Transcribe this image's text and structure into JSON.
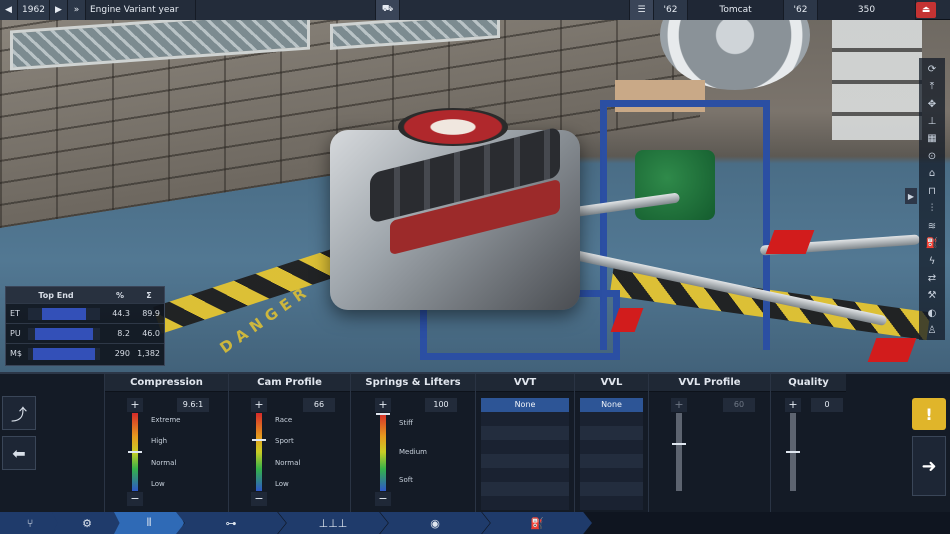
{
  "topbar": {
    "prev_year_icon": "back-arrow-icon",
    "year": "1962",
    "prev_model_icon": "play-left-icon",
    "next_model_icon": "play-right-icon",
    "label": "Engine Variant year",
    "car_icon": "car-icon",
    "list_icon": "list-icon",
    "variant_year": "'62",
    "variant_name": "Tomcat",
    "family_year": "'62",
    "family_value": "350",
    "exit_icon": "exit-icon"
  },
  "right_tools": [
    "refresh-icon",
    "lift-icon",
    "camera-icon",
    "valve-icon",
    "block-icon",
    "cam-icon",
    "head-icon",
    "piston-icon",
    "intake-icon",
    "exhaust-icon",
    "fuel-icon",
    "spark-icon",
    "move-icon",
    "wrench-icon",
    "oil-icon",
    "person-icon"
  ],
  "stats": {
    "title": "Top End",
    "col_pct": "%",
    "col_sum": "Σ",
    "rows": [
      {
        "label": "ET",
        "pct": "44.3",
        "sum": "89.9",
        "fill": 0.62
      },
      {
        "label": "PU",
        "pct": "8.2",
        "sum": "46.0",
        "fill": 0.8
      },
      {
        "label": "M$",
        "pct": "290",
        "sum": "1,382",
        "fill": 0.85
      }
    ]
  },
  "sections": {
    "compression": {
      "title": "Compression",
      "value": "9.6:1",
      "labels": [
        "Extreme",
        "High",
        "Normal",
        "Low"
      ],
      "level": 0.5
    },
    "cam": {
      "title": "Cam Profile",
      "value": "66",
      "labels": [
        "Race",
        "Sport",
        "Normal",
        "Low"
      ],
      "level": 0.66
    },
    "springs": {
      "title": "Springs & Lifters",
      "value": "100",
      "labels": [
        "Stiff",
        "Medium",
        "Soft"
      ],
      "level": 1.0
    },
    "vvt": {
      "title": "VVT",
      "selected": "None"
    },
    "vvl": {
      "title": "VVL",
      "selected": "None"
    },
    "vvl_profile": {
      "title": "VVL Profile",
      "value": "60",
      "level": 0.6
    },
    "quality": {
      "title": "Quality",
      "value": "0",
      "level": 0.5
    }
  },
  "buttons": {
    "plus": "+",
    "minus": "−",
    "warning_icon": "warning-icon",
    "next_icon": "next-arrow-icon",
    "graph_icon": "graph-icon",
    "back_icon": "back-arrow-icon"
  },
  "bottom_nav": [
    "fork-icon",
    "pistons-icon",
    "valvetrain-icon",
    "conrod-icon",
    "exhaust-manifold-icon",
    "turbo-icon",
    "fuel-pump-icon"
  ],
  "danger_text": "DANGER"
}
